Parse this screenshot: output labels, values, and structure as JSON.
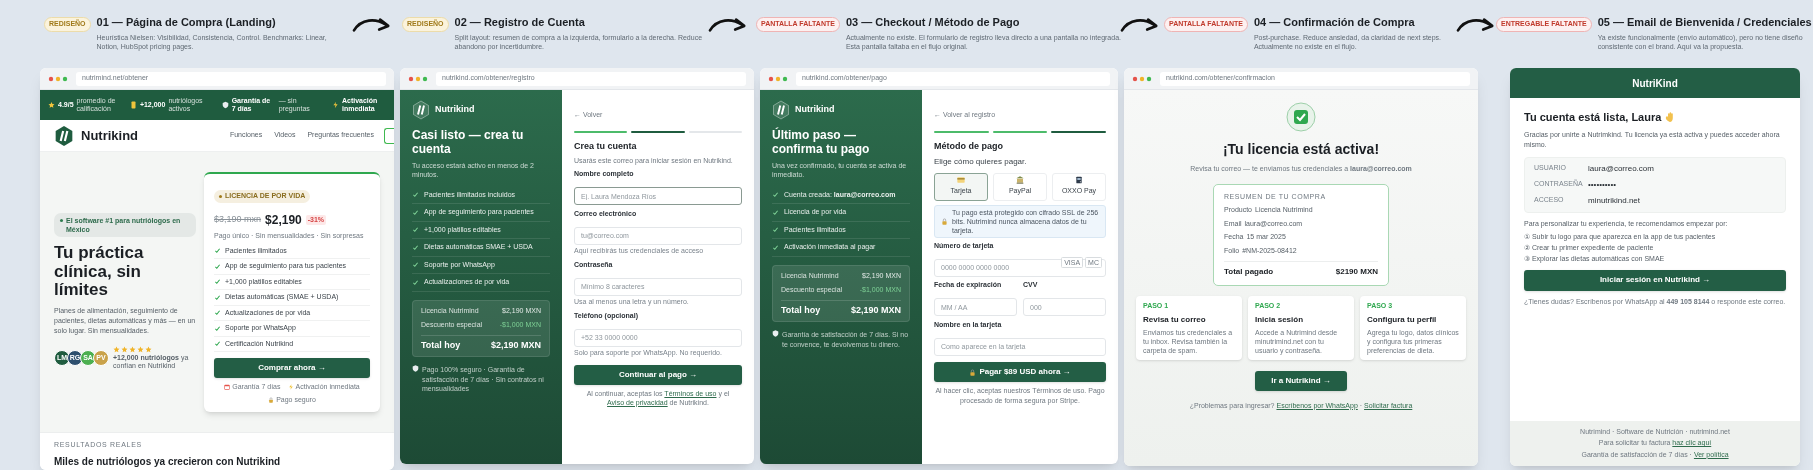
{
  "screens": [
    {
      "kind": "landing",
      "badge": {
        "text": "REDISEÑO",
        "kind": "redesign"
      },
      "title": "01 — Página de Compra (Landing)",
      "subtitle": "Heurística Nielsen: Visibilidad, Consistencia, Control. Benchmarks: Linear, Notion, HubSpot pricing pages.",
      "url": "nutrimind.net/obtener",
      "top_bar": [
        {
          "value": "4.9/5",
          "label": "promedio de calificación"
        },
        {
          "value": "+12,000",
          "label": "nutriólogos activos"
        },
        {
          "value": "Garantía de 7 días",
          "label": "— sin preguntas"
        },
        {
          "value": "Activación inmediata"
        }
      ],
      "brand": "Nutrikind",
      "nav": [
        "Funciones",
        "Videos",
        "Preguntas frecuentes"
      ],
      "hero": {
        "pill": "El software #1 para nutriólogos en México",
        "headline": "Tu práctica clínica, **sin límites**",
        "description": "Planes de alimentación, seguimiento de pacientes, dietas automáticas y más — en un solo lugar. Sin mensualidades.",
        "avatars": [
          {
            "initials": "LM",
            "color": "#1f5c3f"
          },
          {
            "initials": "RG",
            "color": "#2d4f6e"
          },
          {
            "initials": "SA",
            "color": "#4caf50"
          },
          {
            "initials": "PV",
            "color": "#c9a24a"
          }
        ],
        "stars": 5,
        "social_proof": "**+12,000 nutriólogos** ya confían en Nutrikind"
      },
      "offer": {
        "badge": "LICENCIA DE POR VIDA",
        "old_price": "$3,190 mxn",
        "price": "$2,190",
        "discount": "-31%",
        "note": "Pago único · Sin mensualidades · Sin sorpresas",
        "features": [
          "Pacientes ilimitados",
          "App de seguimiento para tus pacientes",
          "+1,000 platillos editables",
          "Dietas automáticas (SMAE + USDA)",
          "Actualizaciones de por vida",
          "Soporte por WhatsApp",
          "Certificación Nutrikind"
        ],
        "button": "Comprar ahora →",
        "trust": [
          "Garantía 7 días",
          "Activación inmediata",
          "Pago seguro"
        ]
      },
      "section": {
        "eyebrow": "RESULTADOS REALES",
        "heading": "Miles de nutriólogos ya crecieron con Nutrikind"
      }
    },
    {
      "kind": "register",
      "badge": {
        "text": "REDISEÑO",
        "kind": "redesign"
      },
      "title": "02 — Registro de Cuenta",
      "subtitle": "Split layout: resumen de compra a la izquierda, formulario a la derecha. Reduce abandono por incertidumbre.",
      "url": "nutrikind.com/obtener/registro",
      "brand": "Nutrikind",
      "heading": "Casi listo — crea tu cuenta",
      "intro": "Tu acceso estará activo en menos de 2 minutos.",
      "features": [
        "Pacientes ilimitados incluidos",
        "App de seguimiento para pacientes",
        "+1,000 platillos editables",
        "Dietas automáticas SMAE + USDA",
        "Soporte por WhatsApp",
        "Actualizaciones de por vida"
      ],
      "summary": {
        "rows": [
          {
            "label": "Licencia Nutrimind",
            "value": "$2,190 MXN",
            "kind": "price"
          },
          {
            "label": "Descuento especial",
            "value": "-$1,000 MXN",
            "kind": "discount"
          }
        ],
        "total_label": "Total hoy",
        "total": "$2,190 MXN"
      },
      "footnote": "Pago 100% seguro · Garantía de satisfacción de 7 días · Sin contratos ni mensualidades",
      "back": "← Volver",
      "steps": [
        {
          "completed": true,
          "active": false
        },
        {
          "completed": false,
          "active": true
        },
        {
          "completed": false,
          "active": false
        }
      ],
      "form_title": "Crea tu cuenta",
      "form_subtitle": "Usarás este correo para iniciar sesión en Nutrikind.",
      "fields": [
        {
          "label": "Nombre completo",
          "placeholder": "Ej. Laura Mendoza Ríos",
          "kind": "full",
          "focused": true
        },
        {
          "label": "Correo electrónico",
          "placeholder": "tu@correo.com",
          "hint": "Aquí recibirás tus credenciales de acceso",
          "kind": "full",
          "focused": false
        },
        {
          "label": "Contraseña",
          "placeholder": "Mínimo 8 caracteres",
          "hint": "Usa al menos una letra y un número.",
          "kind": "full",
          "focused": false
        },
        {
          "label": "Teléfono (opcional)",
          "placeholder": "+52 33 0000 0000",
          "hint": "Solo para soporte por WhatsApp. No requerido.",
          "kind": "full",
          "focused": false
        }
      ],
      "button": "Continuar al pago →",
      "legal": [
        {
          "kind": "text",
          "text": "Al continuar, aceptas los"
        },
        {
          "kind": "link",
          "text": "Términos de uso"
        },
        {
          "kind": "text",
          "text": "y el"
        },
        {
          "kind": "link",
          "text": "Aviso de privacidad"
        },
        {
          "kind": "text",
          "text": "de Nutrikind."
        }
      ]
    },
    {
      "kind": "checkout",
      "badge": {
        "text": "PANTALLA FALTANTE",
        "kind": "missing"
      },
      "title": "03 — Checkout / Método de Pago",
      "subtitle": "Actualmente no existe. El formulario de registro lleva directo a una pantalla no integrada. Esta pantalla faltaba en el flujo original.",
      "url": "nutrikind.com/obtener/pago",
      "brand": "Nutrikind",
      "heading": "Último paso — confirma tu pago",
      "intro": "Una vez confirmado, tu cuenta se activa de inmediato.",
      "features": [
        "Cuenta creada: **laura@correo.com**",
        "Licencia de por vida",
        "Pacientes ilimitados",
        "Activación inmediata al pagar"
      ],
      "summary": {
        "rows": [
          {
            "label": "Licencia Nutrimind",
            "value": "$2,190 MXN",
            "kind": "price"
          },
          {
            "label": "Descuento especial",
            "value": "-$1,000 MXN",
            "kind": "discount"
          }
        ],
        "total_label": "Total hoy",
        "total": "$2,190 MXN"
      },
      "footnote": "Garantía de satisfacción de 7 días. Si no te convence, te devolvemos tu dinero.",
      "back": "← Volver al registro",
      "steps": [
        {
          "completed": true,
          "active": false
        },
        {
          "completed": true,
          "active": false
        },
        {
          "completed": false,
          "active": true
        }
      ],
      "form_title": "Método de pago",
      "form_subtitle": "Elige cómo quieres pagar.",
      "methods": [
        {
          "label": "Tarjeta",
          "selected": true
        },
        {
          "label": "PayPal",
          "selected": false
        },
        {
          "label": "OXXO Pay",
          "selected": false
        }
      ],
      "security": "Tu pago está protegido con cifrado SSL de 256 bits. Nutrimind nunca almacena datos de tu tarjeta.",
      "fields": [
        {
          "label": "Número de tarjeta",
          "placeholder": "0000 0000 0000 0000",
          "brands": [
            "VISA",
            "MC"
          ],
          "kind": "full"
        },
        {
          "label": "Fecha de expiración",
          "placeholder": "MM / AA",
          "kind": "half"
        },
        {
          "label": "CVV",
          "placeholder": "000",
          "kind": "half"
        },
        {
          "label": "Nombre en la tarjeta",
          "placeholder": "Como aparece en la tarjeta",
          "kind": "full"
        }
      ],
      "button": "Pagar $89 USD ahora →",
      "legal": [
        {
          "kind": "text",
          "text": "Al hacer clic, aceptas nuestros Términos de uso. Pago procesado de forma segura por Stripe."
        }
      ]
    },
    {
      "kind": "confirmation",
      "badge": {
        "text": "PANTALLA FALTANTE",
        "kind": "missing"
      },
      "title": "04 — Confirmación de Compra",
      "subtitle": "Post-purchase. Reduce ansiedad, da claridad de next steps. Actualmente no existe en el flujo.",
      "url": "nutrikind.com/obtener/confirmacion",
      "heading": "¡Tu licencia está activa!",
      "message": "Revisa tu correo — te enviamos tus credenciales a **laura@correo.com**",
      "summary": {
        "heading": "RESUMEN DE TU COMPRA",
        "rows": [
          {
            "label": "Producto",
            "value": "Licencia Nutrimind"
          },
          {
            "label": "Email",
            "value": "laura@correo.com"
          },
          {
            "label": "Fecha",
            "value": "15 mar 2025"
          },
          {
            "label": "Folio",
            "value": "#NM-2025-08412"
          }
        ],
        "total_label": "Total pagado",
        "total": "$2190 MXN"
      },
      "next_steps": [
        {
          "step": "PASO 1",
          "title": "Revisa tu correo",
          "text": "Enviamos tus credenciales a tu inbox. Revisa también la carpeta de spam."
        },
        {
          "step": "PASO 2",
          "title": "Inicia sesión",
          "text": "Accede a Nutrimind desde minutrimind.net con tu usuario y contraseña."
        },
        {
          "step": "PASO 3",
          "title": "Configura tu perfil",
          "text": "Agrega tu logo, datos clínicos y configura tus primeras preferencias de dieta."
        }
      ],
      "button": "Ir a Nutrikind →",
      "help": [
        {
          "kind": "text",
          "text": "¿Problemas para ingresar?"
        },
        {
          "kind": "link",
          "text": "Escríbenos por WhatsApp"
        },
        {
          "kind": "text",
          "text": "·"
        },
        {
          "kind": "link",
          "text": "Solicitar factura"
        }
      ]
    },
    {
      "kind": "email",
      "badge": {
        "text": "ENTREGABLE FALTANTE",
        "kind": "missing"
      },
      "title": "05 — Email de Bienvenida / Credenciales",
      "subtitle": "Ya existe funcionalmente (envío automático), pero no tiene diseño consistente con el brand. Aquí va la propuesta.",
      "brand": "NutriKind",
      "greeting": "Tu cuenta está lista, Laura",
      "intro": "Gracias por unirte a Nutrimkind. Tu licencia ya está activa y puedes acceder ahora mismo.",
      "credentials": [
        {
          "label": "USUARIO",
          "value": "laura@correo.com"
        },
        {
          "label": "CONTRASEÑA",
          "value": "••••••••••"
        },
        {
          "label": "ACCESO",
          "value": "minutrikind.net"
        }
      ],
      "recommend": "Para personalizar tu experiencia, te recomendamos empezar por:",
      "tips": [
        "① Subir tu logo para que aparezca en la app de tus pacientes",
        "② Crear tu primer expediente de paciente",
        "③ Explorar las dietas automáticas con SMAE"
      ],
      "button": "Iniciar sesión en Nutrikind →",
      "help": "¿Tienes dudas? Escríbenos por WhatsApp al **449 105 8144** o responde este correo.",
      "footer": [
        [
          {
            "kind": "text",
            "text": "Nutrimind · Software de Nutrición · nutrimind.net"
          }
        ],
        [
          {
            "kind": "text",
            "text": "Para solicitar tu factura"
          },
          {
            "kind": "link",
            "text": "haz clic aquí"
          }
        ],
        [
          {
            "kind": "text",
            "text": "Garantía de satisfacción de 7 días ·"
          },
          {
            "kind": "link",
            "text": "Ver política"
          }
        ]
      ]
    }
  ]
}
